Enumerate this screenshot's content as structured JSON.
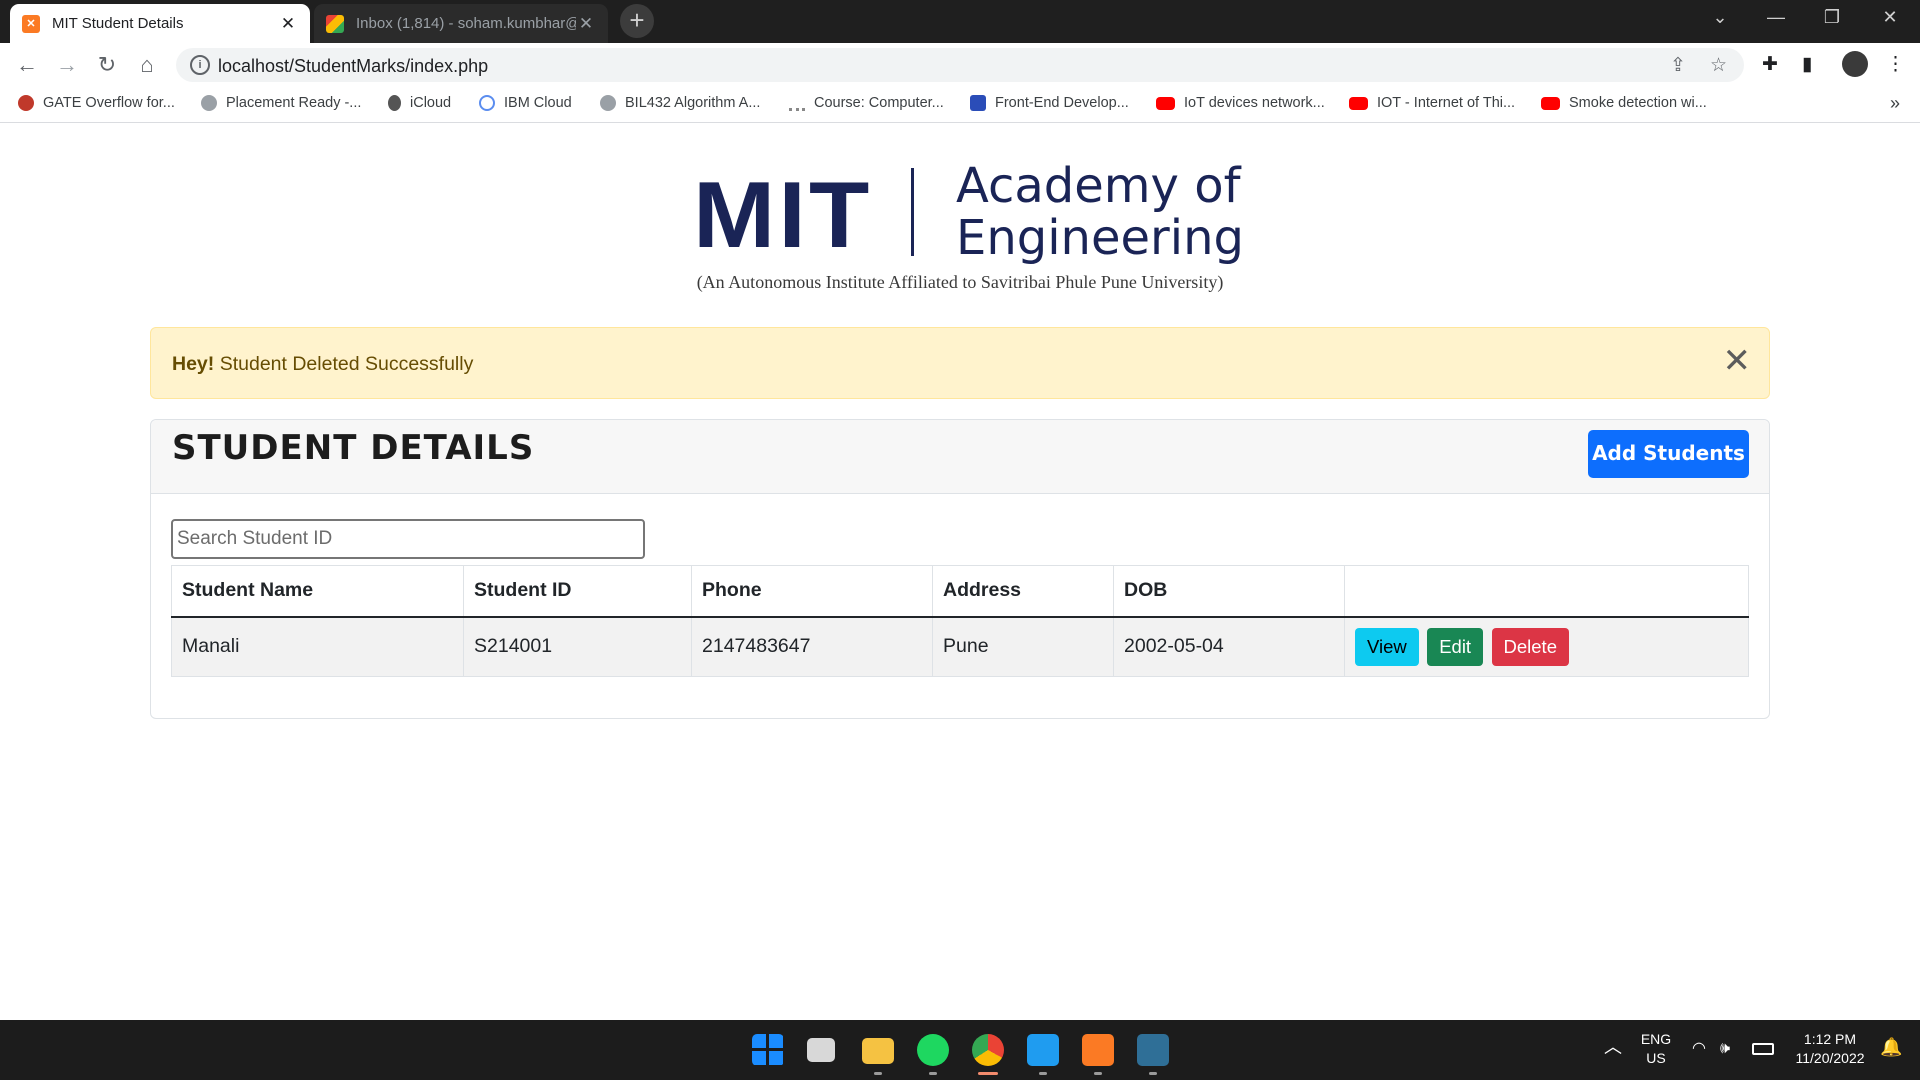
{
  "browser": {
    "tabs": [
      {
        "title": "MIT Student Details",
        "active": true
      },
      {
        "title": "Inbox (1,814) - soham.kumbhar@",
        "active": false
      }
    ],
    "url": "localhost/StudentMarks/index.php",
    "bookmarks": [
      "GATE Overflow for...",
      "Placement Ready -...",
      "iCloud",
      "IBM Cloud",
      "BIL432 Algorithm A...",
      "Course: Computer...",
      "Front-End Develop...",
      "IoT devices network...",
      "IOT - Internet of Thi...",
      "Smoke detection wi..."
    ]
  },
  "logo": {
    "mit": "MIT",
    "line1": "Academy of",
    "line2": "Engineering",
    "subtitle": "(An Autonomous Institute Affiliated to Savitribai Phule Pune University)"
  },
  "alert": {
    "strong": "Hey!",
    "message": " Student Deleted Successfully"
  },
  "card": {
    "title": "STUDENT DETAILS",
    "add_button": "Add Students"
  },
  "search": {
    "placeholder": "Search Student ID"
  },
  "table": {
    "headers": [
      "Student Name",
      "Student ID",
      "Phone",
      "Address",
      "DOB",
      ""
    ],
    "rows": [
      {
        "name": "Manali",
        "id": "S214001",
        "phone": "2147483647",
        "address": "Pune",
        "dob": "2002-05-04"
      }
    ],
    "actions": {
      "view": "View",
      "edit": "Edit",
      "delete": "Delete"
    }
  },
  "taskbar": {
    "lang1": "ENG",
    "lang2": "US",
    "time": "1:12 PM",
    "date": "11/20/2022"
  },
  "colors": {
    "brand_navy": "#1a2456",
    "primary": "#0d6efd",
    "alert_bg": "#fff3cd",
    "view": "#0dcaf0",
    "edit": "#198754",
    "delete": "#dc3545"
  }
}
